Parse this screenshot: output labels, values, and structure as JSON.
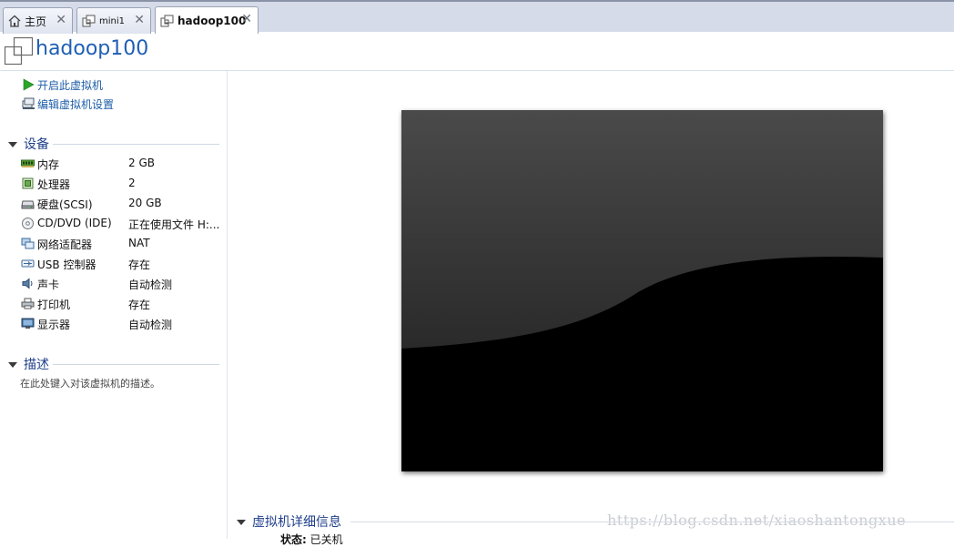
{
  "tabs": [
    {
      "label": "主页",
      "icon": "home-icon",
      "close": "✕"
    },
    {
      "label": "mini1",
      "icon": "vm-icon",
      "close": "✕"
    },
    {
      "label": "hadoop100",
      "icon": "vm-icon",
      "close": "✕",
      "active": true
    }
  ],
  "vm": {
    "title": "hadoop100"
  },
  "actions": [
    {
      "label": "开启此虚拟机",
      "icon": "play-icon"
    },
    {
      "label": "编辑虚拟机设置",
      "icon": "edit-settings-icon"
    }
  ],
  "devices_section": {
    "title": "设备"
  },
  "devices": [
    {
      "name": "内存",
      "value": "2 GB",
      "icon": "memory-icon"
    },
    {
      "name": "处理器",
      "value": "2",
      "icon": "processor-icon"
    },
    {
      "name": "硬盘(SCSI)",
      "value": "20 GB",
      "icon": "hard-disk-icon"
    },
    {
      "name": "CD/DVD (IDE)",
      "value": "正在使用文件 H:...",
      "icon": "cd-dvd-icon"
    },
    {
      "name": "网络适配器",
      "value": "NAT",
      "icon": "network-adapter-icon"
    },
    {
      "name": "USB 控制器",
      "value": "存在",
      "icon": "usb-icon"
    },
    {
      "name": "声卡",
      "value": "自动检测",
      "icon": "sound-card-icon"
    },
    {
      "name": "打印机",
      "value": "存在",
      "icon": "printer-icon"
    },
    {
      "name": "显示器",
      "value": "自动检测",
      "icon": "display-icon"
    }
  ],
  "description_section": {
    "title": "描述",
    "placeholder": "在此处键入对该虚拟机的描述。"
  },
  "details_section": {
    "title": "虚拟机详细信息",
    "status_label": "状态:",
    "status_value": "已关机"
  },
  "watermark": "https://blog.csdn.net/xiaoshantongxue",
  "colors": {
    "link": "#1d5ea8",
    "title": "#1f5fb4",
    "section": "#1f3f8a",
    "tabbar": "#d6dbe9"
  }
}
